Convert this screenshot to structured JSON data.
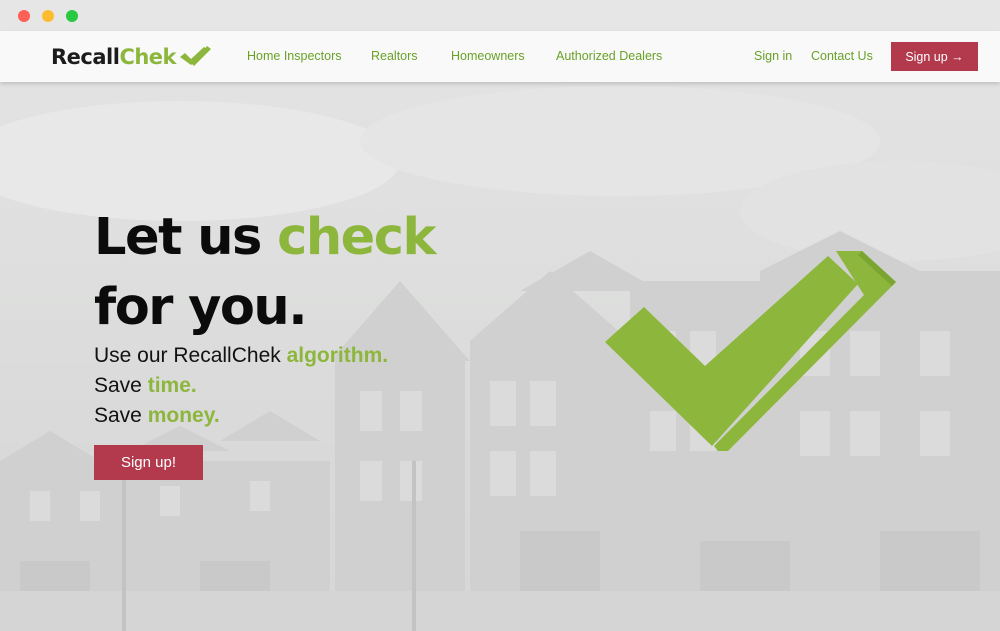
{
  "brand": {
    "name_part1": "Recall",
    "name_part2": "Chek",
    "accent": "#8db63c",
    "cta_color": "#b23a4c"
  },
  "nav": {
    "links": [
      "Home Inspectors",
      "Realtors",
      "Homeowners",
      "Authorized Dealers"
    ],
    "sign_in": "Sign in",
    "contact": "Contact Us",
    "signup": "Sign up →"
  },
  "hero": {
    "line1_a": "Let us ",
    "line1_b": "check",
    "line2": "for you.",
    "sub1_a": "Use our RecallChek ",
    "sub1_b": "algorithm.",
    "sub2_a": "Save ",
    "sub2_b": "time.",
    "sub3_a": "Save ",
    "sub3_b": "money.",
    "cta": "Sign up!"
  },
  "icons": {
    "logo_check": "check-icon",
    "hero_check": "checkmark-icon"
  }
}
